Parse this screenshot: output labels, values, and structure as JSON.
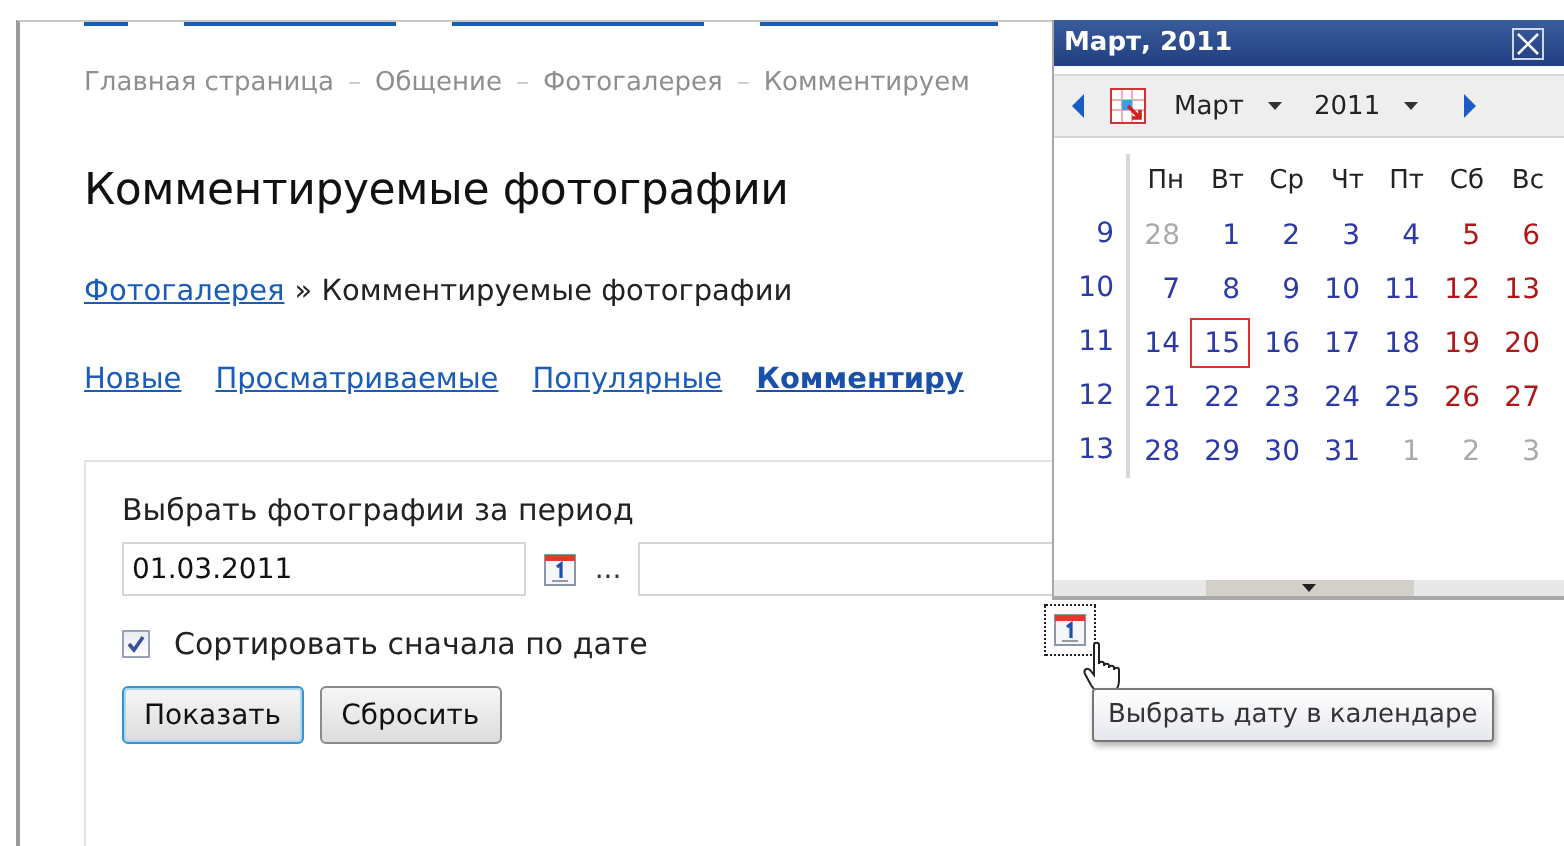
{
  "breadcrumb": [
    {
      "kind": "link",
      "text": "Главная страница"
    },
    {
      "kind": "separator",
      "text": "–"
    },
    {
      "kind": "link",
      "text": "Общение"
    },
    {
      "kind": "separator",
      "text": "–"
    },
    {
      "kind": "link",
      "text": "Фотогалерея"
    },
    {
      "kind": "separator",
      "text": "–"
    },
    {
      "kind": "link",
      "text": "Комментируем"
    }
  ],
  "title": "Комментируемые фотографии",
  "path": {
    "link": "Фотогалерея",
    "rest": "» Комментируемые фотографии"
  },
  "tabs": [
    {
      "label": "Новые",
      "selected": false
    },
    {
      "label": "Просматриваемые",
      "selected": false
    },
    {
      "label": "Популярные",
      "selected": false
    },
    {
      "label": "Комментиру",
      "selected": true
    }
  ],
  "form": {
    "label": "Выбрать фотографии за период",
    "from_value": "01.03.2011",
    "range_mark": "...",
    "sort": {
      "label": "Сортировать сначала по дате",
      "checked": true
    },
    "buttons": [
      {
        "label": "Показать",
        "default": true
      },
      {
        "label": "Сбросить",
        "default": false
      }
    ]
  },
  "calendar": {
    "title": "Март, 2011",
    "month": "Март",
    "year": "2011",
    "weekdays": [
      "Пн",
      "Вт",
      "Ср",
      "Чт",
      "Пт",
      "Сб",
      "Вс"
    ],
    "weeks": [
      {
        "number": "9",
        "days": [
          {
            "d": "28",
            "kind": "other",
            "selected": false
          },
          {
            "d": "1",
            "kind": "work",
            "selected": false
          },
          {
            "d": "2",
            "kind": "work",
            "selected": false
          },
          {
            "d": "3",
            "kind": "work",
            "selected": false
          },
          {
            "d": "4",
            "kind": "work",
            "selected": false
          },
          {
            "d": "5",
            "kind": "weekend",
            "selected": false
          },
          {
            "d": "6",
            "kind": "weekend",
            "selected": false
          }
        ]
      },
      {
        "number": "10",
        "days": [
          {
            "d": "7",
            "kind": "work",
            "selected": false
          },
          {
            "d": "8",
            "kind": "work",
            "selected": false
          },
          {
            "d": "9",
            "kind": "work",
            "selected": false
          },
          {
            "d": "10",
            "kind": "work",
            "selected": false
          },
          {
            "d": "11",
            "kind": "work",
            "selected": false
          },
          {
            "d": "12",
            "kind": "weekend",
            "selected": false
          },
          {
            "d": "13",
            "kind": "weekend",
            "selected": false
          }
        ]
      },
      {
        "number": "11",
        "days": [
          {
            "d": "14",
            "kind": "work",
            "selected": false
          },
          {
            "d": "15",
            "kind": "work",
            "selected": true
          },
          {
            "d": "16",
            "kind": "work",
            "selected": false
          },
          {
            "d": "17",
            "kind": "work",
            "selected": false
          },
          {
            "d": "18",
            "kind": "work",
            "selected": false
          },
          {
            "d": "19",
            "kind": "weekend",
            "selected": false
          },
          {
            "d": "20",
            "kind": "weekend",
            "selected": false
          }
        ]
      },
      {
        "number": "12",
        "days": [
          {
            "d": "21",
            "kind": "work",
            "selected": false
          },
          {
            "d": "22",
            "kind": "work",
            "selected": false
          },
          {
            "d": "23",
            "kind": "work",
            "selected": false
          },
          {
            "d": "24",
            "kind": "work",
            "selected": false
          },
          {
            "d": "25",
            "kind": "work",
            "selected": false
          },
          {
            "d": "26",
            "kind": "weekend",
            "selected": false
          },
          {
            "d": "27",
            "kind": "weekend",
            "selected": false
          }
        ]
      },
      {
        "number": "13",
        "days": [
          {
            "d": "28",
            "kind": "work",
            "selected": false
          },
          {
            "d": "29",
            "kind": "work",
            "selected": false
          },
          {
            "d": "30",
            "kind": "work",
            "selected": false
          },
          {
            "d": "31",
            "kind": "work",
            "selected": false
          },
          {
            "d": "1",
            "kind": "other",
            "selected": false
          },
          {
            "d": "2",
            "kind": "other",
            "selected": false
          },
          {
            "d": "3",
            "kind": "other",
            "selected": false
          }
        ]
      }
    ]
  },
  "tooltip": "Выбрать дату в календаре"
}
